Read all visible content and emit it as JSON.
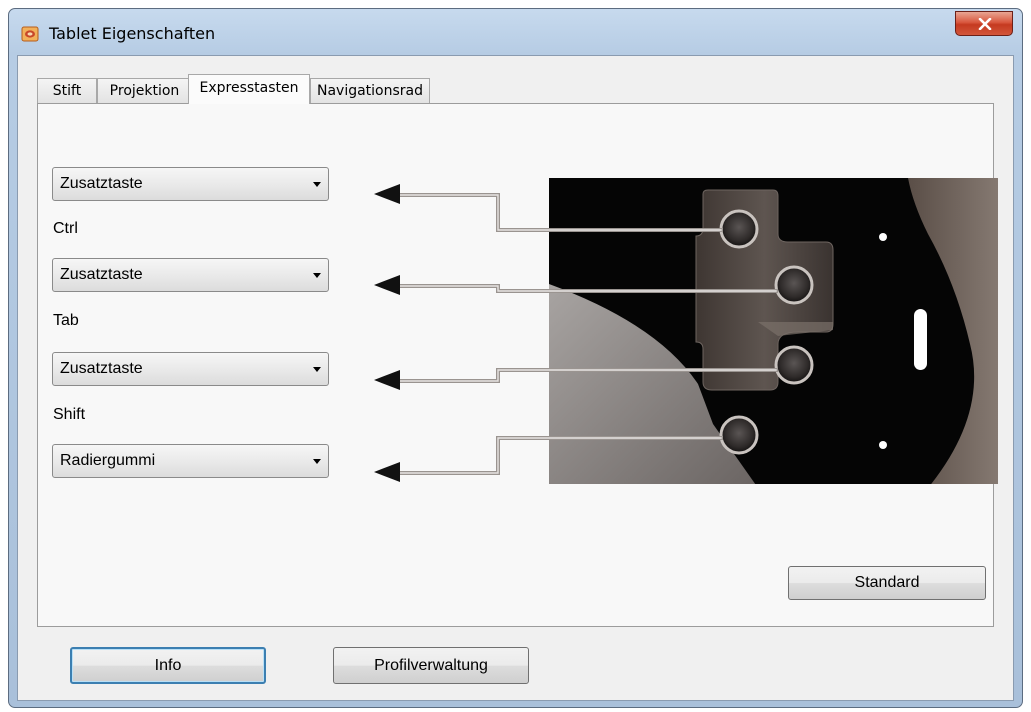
{
  "window": {
    "title": "Tablet Eigenschaften"
  },
  "tabs": [
    {
      "label": "Stift"
    },
    {
      "label": "Projektion"
    },
    {
      "label": "Expresstasten"
    },
    {
      "label": "Navigationsrad"
    }
  ],
  "active_tab": "Expresstasten",
  "express_keys": [
    {
      "selected": "Zusatztaste",
      "modifier": "Ctrl"
    },
    {
      "selected": "Zusatztaste",
      "modifier": "Tab"
    },
    {
      "selected": "Zusatztaste",
      "modifier": "Shift"
    },
    {
      "selected": "Radiergummi",
      "modifier": ""
    }
  ],
  "buttons": {
    "standard": "Standard",
    "info": "Info",
    "profile": "Profilverwaltung"
  },
  "icons": {
    "app": "tablet-app-icon",
    "close": "close-icon",
    "dropdown": "chevron-down-icon",
    "arrow": "arrow-left-icon"
  },
  "colors": {
    "title_bar": "#b6cce4",
    "close_button": "#c9472c",
    "default_button_border": "#3c7fb1",
    "tablet_body": "#000000"
  }
}
